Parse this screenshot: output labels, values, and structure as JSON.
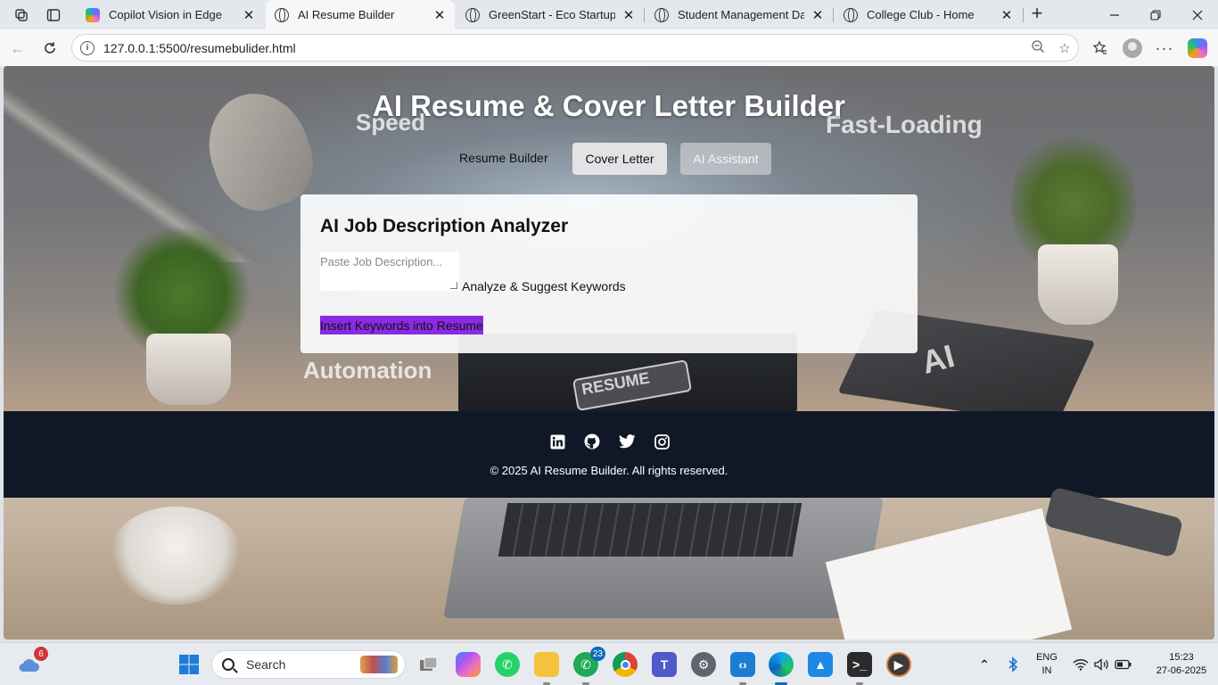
{
  "browser": {
    "tabs": [
      {
        "title": "Copilot Vision in Edge",
        "active": false,
        "icon": "copilot-icon"
      },
      {
        "title": "AI Resume Builder",
        "active": true,
        "icon": "globe-icon"
      },
      {
        "title": "GreenStart - Eco Startup Lan",
        "active": false,
        "icon": "globe-icon"
      },
      {
        "title": "Student Management Dashb",
        "active": false,
        "icon": "globe-icon"
      },
      {
        "title": "College Club - Home",
        "active": false,
        "icon": "globe-icon"
      }
    ],
    "url": "127.0.0.1:5500/resumebulider.html"
  },
  "page": {
    "title": "AI Resume & Cover Letter Builder",
    "background_words": [
      "Speed",
      "Fast-Loading",
      "Automation",
      "RESUME",
      "AI"
    ],
    "nav": {
      "resume_builder": "Resume Builder",
      "cover_letter": "Cover Letter",
      "ai_assistant": "AI Assistant"
    },
    "analyzer": {
      "heading": "AI Job Description Analyzer",
      "placeholder": "Paste Job Description...",
      "analyze_label": "Analyze & Suggest Keywords",
      "insert_label": "Insert Keywords into Resume",
      "insert_color": "#8a2be2"
    },
    "footer": {
      "socials": [
        "linkedin-icon",
        "github-icon",
        "twitter-icon",
        "instagram-icon"
      ],
      "copyright": "© 2025 AI Resume Builder. All rights reserved.",
      "bg_color": "#101828"
    }
  },
  "taskbar": {
    "weather_badge": "6",
    "search_label": "Search",
    "whatsapp_badge": "23",
    "language": "ENG",
    "region": "IN",
    "time": "15:23",
    "date": "27-06-2025"
  }
}
